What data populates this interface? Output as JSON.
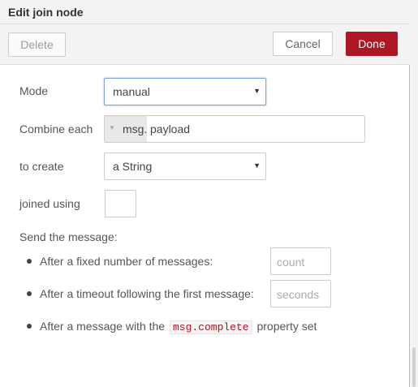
{
  "header": {
    "title": "Edit join node"
  },
  "toolbar": {
    "delete_label": "Delete",
    "cancel_label": "Cancel",
    "done_label": "Done"
  },
  "form": {
    "mode": {
      "label": "Mode",
      "value": "manual"
    },
    "combine": {
      "label": "Combine each",
      "prefix": "msg.",
      "value": "payload"
    },
    "create": {
      "label": "to create",
      "value": "a String"
    },
    "joiner": {
      "label": "joined using",
      "value": ""
    },
    "send": {
      "heading": "Send the message:",
      "count": {
        "text": "After a fixed number of messages:",
        "placeholder": "count"
      },
      "timeout": {
        "text": "After a timeout following the first message:",
        "placeholder": "seconds"
      },
      "complete": {
        "text_before": "After a message with the",
        "code": "msg.complete",
        "text_after": "property set"
      }
    }
  },
  "colors": {
    "done_button": "#ad1625",
    "code_text": "#ad1625",
    "focus_border": "#7fa4d9"
  },
  "icons": {
    "select_arrow": "caret-down-icon",
    "type_caret": "caret-down-icon"
  }
}
